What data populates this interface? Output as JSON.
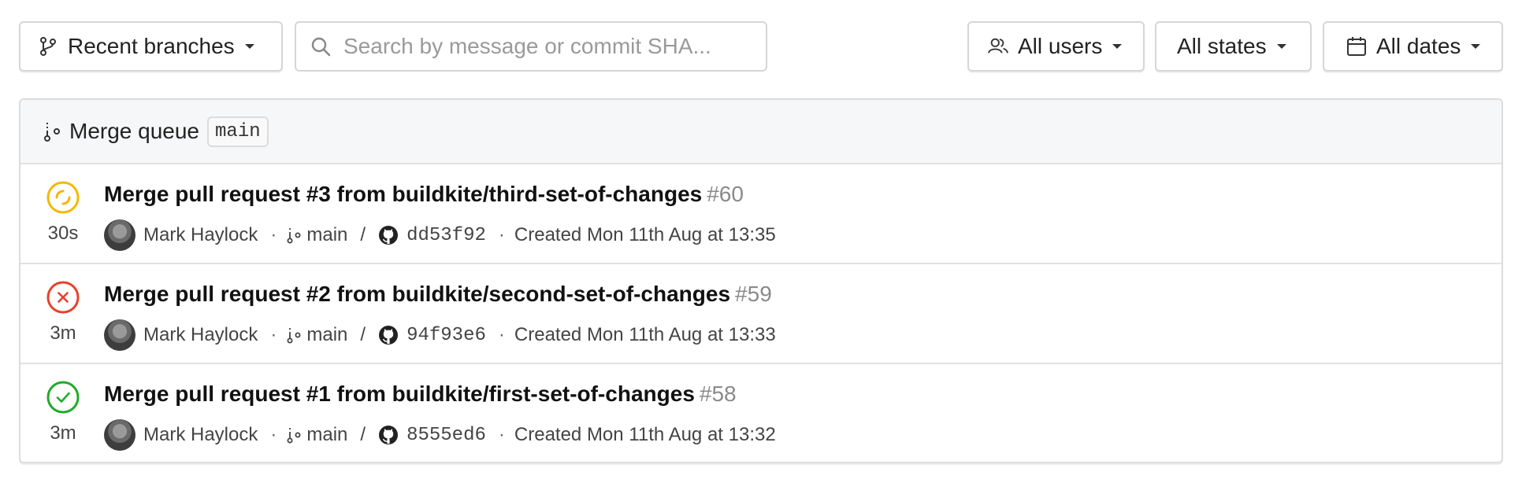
{
  "toolbar": {
    "branches_label": "Recent branches",
    "search_placeholder": "Search by message or commit SHA...",
    "users_label": "All users",
    "states_label": "All states",
    "dates_label": "All dates"
  },
  "panel": {
    "title": "Merge queue",
    "branch_tag": "main"
  },
  "builds": [
    {
      "status": "running",
      "status_color": "#f5b800",
      "duration": "30s",
      "title": "Merge pull request #3 from buildkite/third-set-of-changes",
      "number": "#60",
      "author": "Mark Haylock",
      "branch": "main",
      "sha": "dd53f92",
      "created": "Created Mon 11th Aug at 13:35"
    },
    {
      "status": "failed",
      "status_color": "#e8412b",
      "duration": "3m",
      "title": "Merge pull request #2 from buildkite/second-set-of-changes",
      "number": "#59",
      "author": "Mark Haylock",
      "branch": "main",
      "sha": "94f93e6",
      "created": "Created Mon 11th Aug at 13:33"
    },
    {
      "status": "passed",
      "status_color": "#1fab28",
      "duration": "3m",
      "title": "Merge pull request #1 from buildkite/first-set-of-changes",
      "number": "#58",
      "author": "Mark Haylock",
      "branch": "main",
      "sha": "8555ed6",
      "created": "Created Mon 11th Aug at 13:32"
    }
  ],
  "meta": {
    "separator_dot": "·",
    "separator_slash": "/"
  },
  "icons": {
    "branches": "git-branch-icon",
    "search": "search-icon",
    "users": "users-icon",
    "dates": "calendar-icon",
    "merge_queue": "merge-queue-icon",
    "github": "github-icon"
  }
}
